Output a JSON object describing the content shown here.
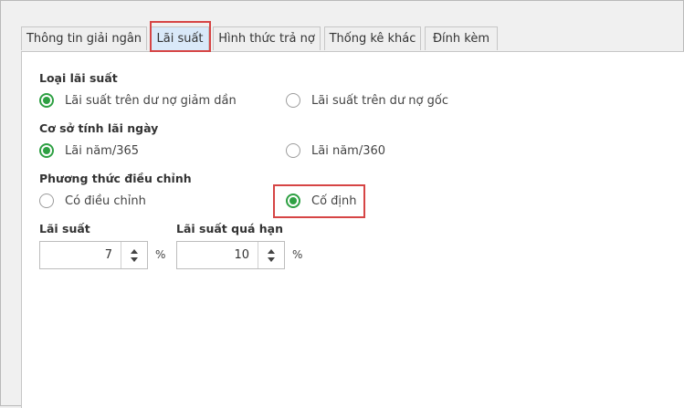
{
  "tabs": [
    {
      "label": "Thông tin giải ngân"
    },
    {
      "label": "Lãi suất"
    },
    {
      "label": "Hình thức trả nợ"
    },
    {
      "label": "Thống kê khác"
    },
    {
      "label": "Đính kèm"
    }
  ],
  "active_tab": "Lãi suất",
  "interest_type": {
    "label": "Loại lãi suất",
    "options": [
      {
        "label": "Lãi suất trên dư nợ giảm dần",
        "checked": true
      },
      {
        "label": "Lãi suất trên dư nợ gốc",
        "checked": false
      }
    ]
  },
  "daily_basis": {
    "label": "Cơ sở tính lãi ngày",
    "options": [
      {
        "label": "Lãi năm/365",
        "checked": true
      },
      {
        "label": "Lãi năm/360",
        "checked": false
      }
    ]
  },
  "adjustment_method": {
    "label": "Phương thức điều chỉnh",
    "options": [
      {
        "label": "Có điều chỉnh",
        "checked": false
      },
      {
        "label": "Cố định",
        "checked": true
      }
    ]
  },
  "interest_rate": {
    "label": "Lãi suất",
    "value": "7",
    "unit": "%"
  },
  "overdue_rate": {
    "label": "Lãi suất quá hạn",
    "value": "10",
    "unit": "%"
  },
  "colors": {
    "radio_checked": "#2ea043",
    "highlight": "#d64545",
    "active_tab": "#d9e9f9"
  }
}
